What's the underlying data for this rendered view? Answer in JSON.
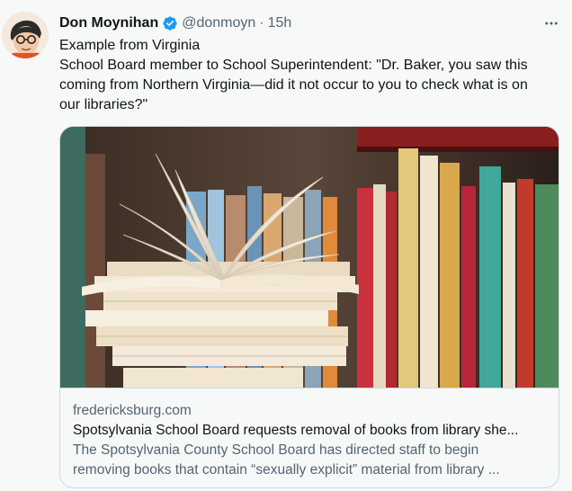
{
  "author": {
    "name": "Don Moynihan",
    "handle": "@donmoyn",
    "separator": "·",
    "time": "15h",
    "verified_color": "#1d9bf0"
  },
  "more_icon": "more-horizontal-icon",
  "tweet": {
    "lines": [
      "Example from Virginia",
      "School Board member to School Superintendent: \"Dr. Baker, you saw this",
      "coming from Northern Virginia—did it not occur to you to check what is on",
      "our libraries?\""
    ]
  },
  "card": {
    "image_subject": "open book on stack of books in front of library shelf",
    "domain": "fredericksburg.com",
    "title": "Spotsylvania School Board requests removal of books from library she...",
    "description_lines": [
      "The Spotsylvania County School Board has directed staff to begin",
      "removing books that contain “sexually explicit” material from library ..."
    ]
  },
  "colors": {
    "text": "#0f1419",
    "secondary": "#536471",
    "border": "#cfd9de",
    "background": "#f7f9f9"
  }
}
